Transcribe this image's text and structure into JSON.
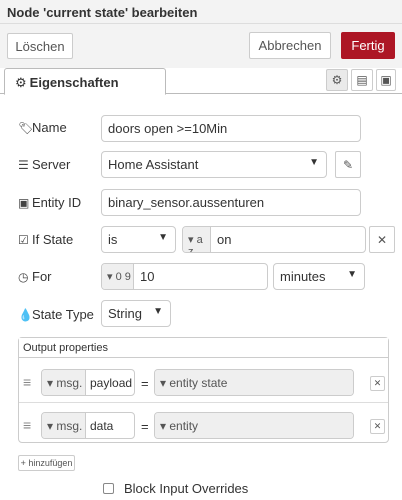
{
  "dialog": {
    "title": "Node 'current state' bearbeiten"
  },
  "actions": {
    "delete_label": "Löschen",
    "cancel_label": "Abbrechen",
    "done_label": "Fertig",
    "accent_color": "#ad1625"
  },
  "tabs": {
    "properties_label": "Eigenschaften",
    "properties_icon": "gear-icon",
    "side_icons": [
      "gear-icon",
      "description-icon",
      "appearance-icon"
    ]
  },
  "form": {
    "name": {
      "label": "Name",
      "icon": "tag-icon",
      "value": "doors open >=10Min"
    },
    "server": {
      "label": "Server",
      "icon": "server-icon",
      "value": "Home Assistant",
      "edit_icon": "pencil-icon"
    },
    "entity_id": {
      "label": "Entity ID",
      "icon": "cube-icon",
      "value": "binary_sensor.aussenturen"
    },
    "if_state": {
      "label": "If State",
      "icon": "check-square-icon",
      "operator": "is",
      "type_glyph": "a z",
      "value": "on",
      "clear_icon": "close-icon"
    },
    "for": {
      "label": "For",
      "icon": "clock-icon",
      "type_glyph": "0 9",
      "value": "10",
      "unit": "minutes"
    },
    "state_type": {
      "label": "State Type",
      "icon": "drop-icon",
      "value": "String"
    }
  },
  "output": {
    "header": "Output properties",
    "rows": [
      {
        "prefix": "msg.",
        "property": "payload",
        "equals": "=",
        "value": "entity state"
      },
      {
        "prefix": "msg.",
        "property": "data",
        "equals": "=",
        "value": "entity"
      }
    ],
    "add_label": "+ hinzufügen"
  },
  "options": {
    "block_input_overrides": {
      "label": "Block Input Overrides",
      "checked": false
    }
  }
}
